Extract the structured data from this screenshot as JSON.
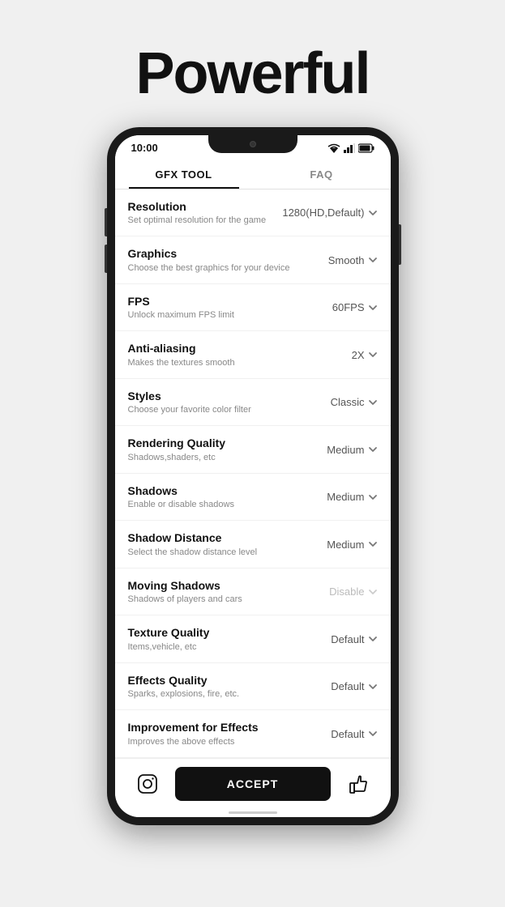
{
  "page": {
    "title": "Powerful"
  },
  "tabs": {
    "active": "GFX TOOL",
    "items": [
      "GFX TOOL",
      "FAQ"
    ]
  },
  "status": {
    "time": "10:00"
  },
  "settings": [
    {
      "name": "Resolution",
      "desc": "Set optimal resolution for the game",
      "value": "1280(HD,Default)",
      "disabled": false
    },
    {
      "name": "Graphics",
      "desc": "Choose the best graphics for your device",
      "value": "Smooth",
      "disabled": false
    },
    {
      "name": "FPS",
      "desc": "Unlock maximum FPS limit",
      "value": "60FPS",
      "disabled": false
    },
    {
      "name": "Anti-aliasing",
      "desc": "Makes the textures smooth",
      "value": "2X",
      "disabled": false
    },
    {
      "name": "Styles",
      "desc": "Choose your favorite color filter",
      "value": "Classic",
      "disabled": false
    },
    {
      "name": "Rendering Quality",
      "desc": "Shadows,shaders, etc",
      "value": "Medium",
      "disabled": false
    },
    {
      "name": "Shadows",
      "desc": "Enable or disable shadows",
      "value": "Medium",
      "disabled": false
    },
    {
      "name": "Shadow Distance",
      "desc": "Select the shadow distance level",
      "value": "Medium",
      "disabled": false
    },
    {
      "name": "Moving Shadows",
      "desc": "Shadows of players and cars",
      "value": "Disable",
      "disabled": true
    },
    {
      "name": "Texture Quality",
      "desc": "Items,vehicle, etc",
      "value": "Default",
      "disabled": false
    },
    {
      "name": "Effects Quality",
      "desc": "Sparks, explosions, fire, etc.",
      "value": "Default",
      "disabled": false
    },
    {
      "name": "Improvement for Effects",
      "desc": "Improves the above effects",
      "value": "Default",
      "disabled": false
    }
  ],
  "bottom": {
    "accept_label": "ACCEPT"
  }
}
